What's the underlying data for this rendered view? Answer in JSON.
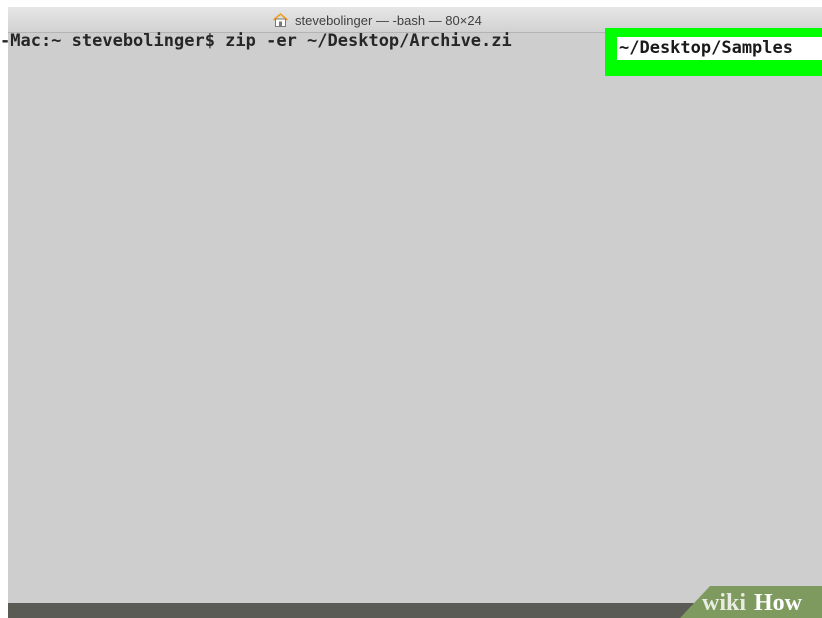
{
  "window": {
    "title": "stevebolinger — -bash — 80×24",
    "home_icon": "home-icon"
  },
  "terminal": {
    "prompt": "-Mac:~ stevebolinger$ ",
    "command": "zip -er ~/Desktop/Archive.zi",
    "highlighted_argument": "~/Desktop/Samples"
  },
  "colors": {
    "terminal_background": "#cecece",
    "highlight": "#00ff00",
    "bottom_bar": "#595b54"
  },
  "watermark": {
    "text": "wikiHow",
    "part1": "wiki",
    "part2": "How"
  }
}
